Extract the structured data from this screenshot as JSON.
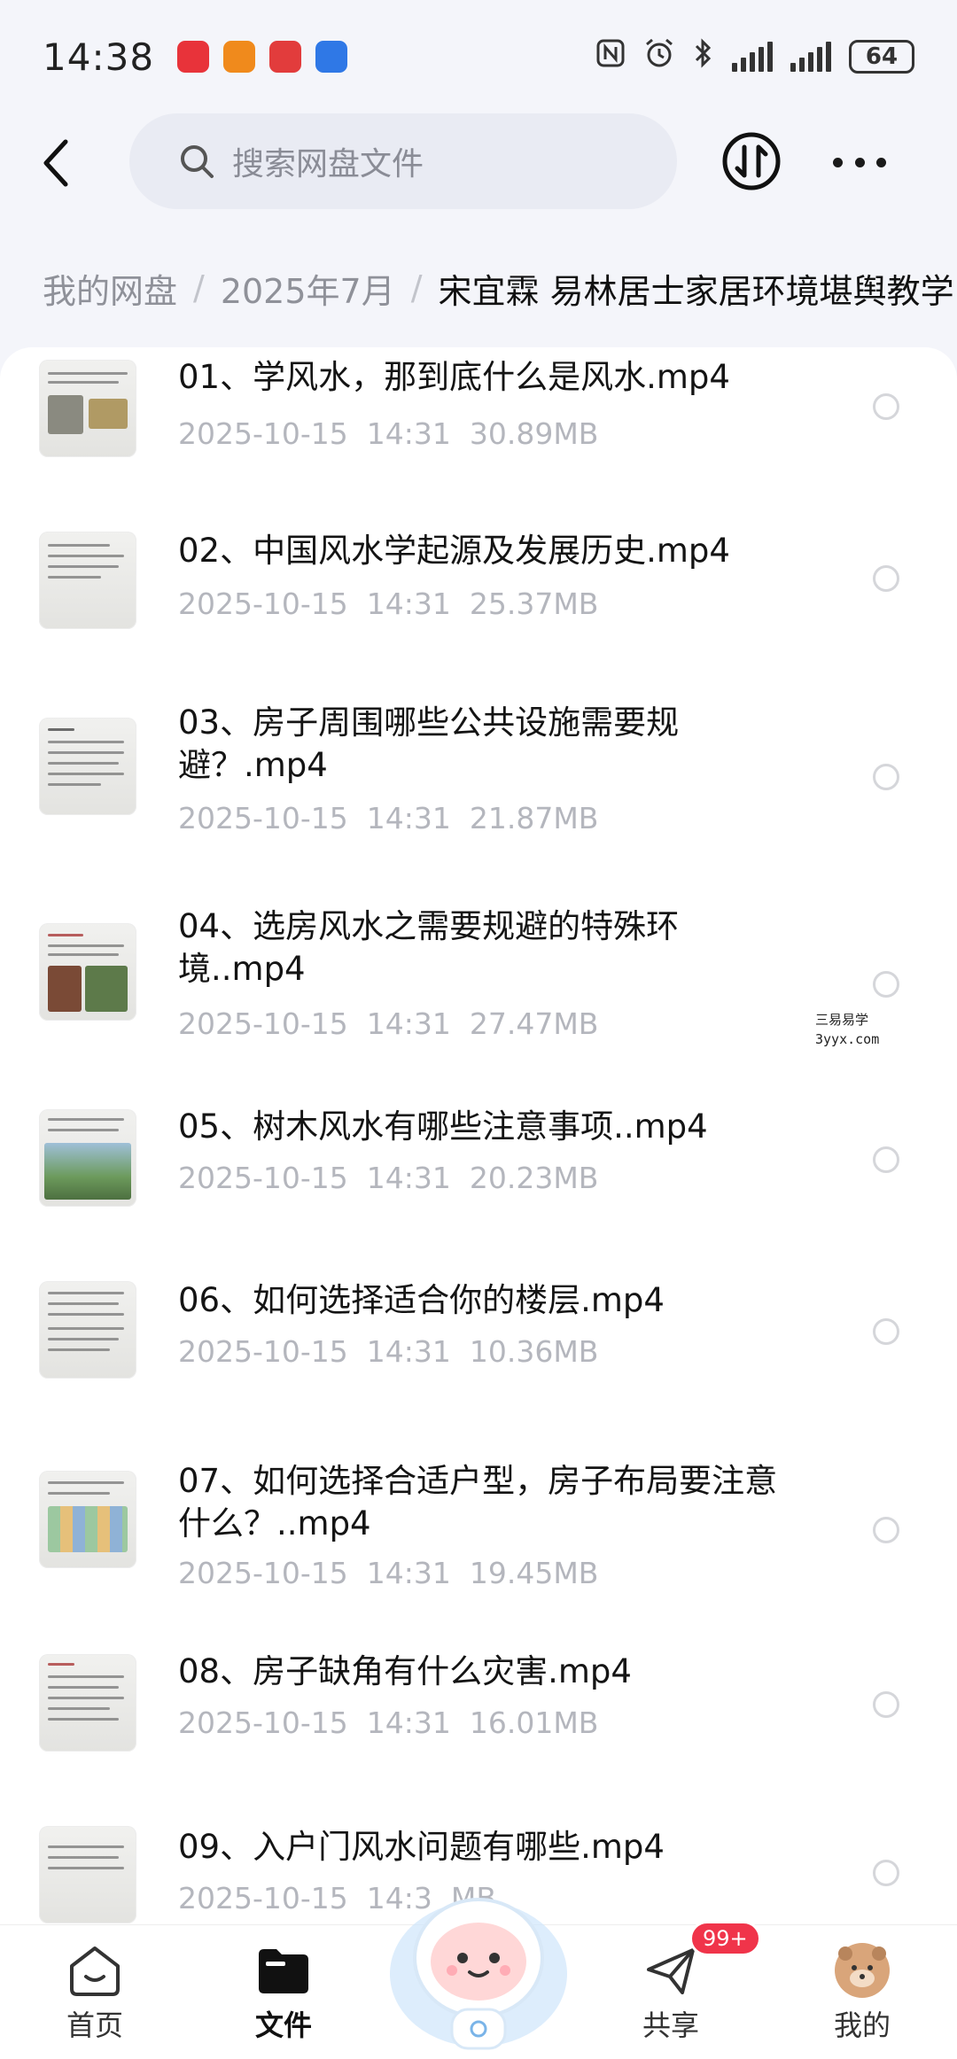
{
  "status": {
    "time": "14:38",
    "battery": "64"
  },
  "header": {
    "search_placeholder": "搜索网盘文件"
  },
  "breadcrumb": [
    "我的网盘",
    "2025年7月",
    "宋宜霖 易林居士家居环境堪舆教学"
  ],
  "files": [
    {
      "name": "01、学风水，那到底什么是风水.mp4",
      "date": "2025-10-15  14:31",
      "size": "30.89MB"
    },
    {
      "name": "02、中国风水学起源及发展历史.mp4",
      "date": "2025-10-15  14:31",
      "size": "25.37MB"
    },
    {
      "name": "03、房子周围哪些公共设施需要规避？.mp4",
      "date": "2025-10-15  14:31",
      "size": "21.87MB"
    },
    {
      "name": "04、选房风水之需要规避的特殊环境..mp4",
      "date": "2025-10-15  14:31",
      "size": "27.47MB"
    },
    {
      "name": "05、树木风水有哪些注意事项..mp4",
      "date": "2025-10-15  14:31",
      "size": "20.23MB"
    },
    {
      "name": "06、如何选择适合你的楼层.mp4",
      "date": "2025-10-15  14:31",
      "size": "10.36MB"
    },
    {
      "name": "07、如何选择合适户型，房子布局要注意什么？..mp4",
      "date": "2025-10-15  14:31",
      "size": "19.45MB"
    },
    {
      "name": "08、房子缺角有什么灾害.mp4",
      "date": "2025-10-15  14:31",
      "size": "16.01MB"
    },
    {
      "name": "09、入户门风水问题有哪些.mp4",
      "date": "2025-10-15  14:3",
      "size": "MB"
    }
  ],
  "watermark": {
    "line1": "三易易学",
    "line2": "3yyx.com"
  },
  "nav": {
    "home": "首页",
    "files": "文件",
    "share": "共享",
    "mine": "我的",
    "share_badge": "99+"
  }
}
